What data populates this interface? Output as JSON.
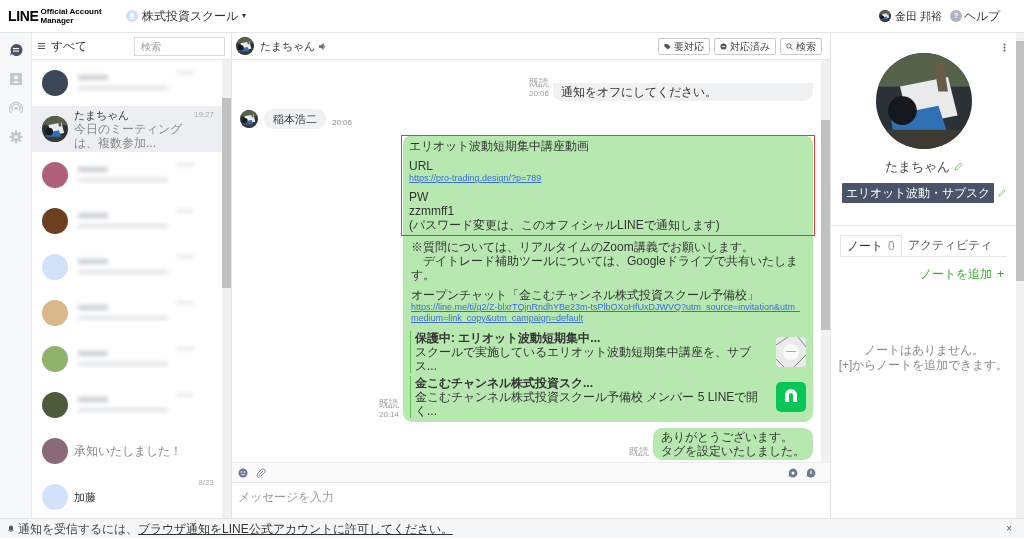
{
  "header": {
    "logo_main": "LINE",
    "logo_sub": "Official Account Manager",
    "account": "株式投資スクール",
    "account_caret": "▾",
    "user": "金田 邦裕",
    "help": "ヘルプ",
    "help_mark": "?"
  },
  "rail": [
    {
      "kind": "chat",
      "selected": true
    },
    {
      "kind": "contacts",
      "selected": false
    },
    {
      "kind": "broadcast",
      "selected": false
    },
    {
      "kind": "settings",
      "selected": false
    }
  ],
  "chat_list": {
    "filter": "すべて",
    "search_placeholder": "検索",
    "items": [
      {
        "kind": "blurred",
        "color": "#3b4656",
        "selected": false
      },
      {
        "kind": "contact",
        "name": "たまちゃん",
        "preview": "今日のミーティングは、複数参加...",
        "time": "19:27",
        "selected": true
      },
      {
        "kind": "blurred",
        "color": "#b0607a",
        "selected": false
      },
      {
        "kind": "blurred",
        "color": "#6b4020",
        "selected": false
      },
      {
        "kind": "blurred",
        "color": "#d3e2fb",
        "selected": false
      },
      {
        "kind": "blurred",
        "color": "#d9b88a",
        "selected": false
      },
      {
        "kind": "blurred",
        "color": "#8fb36a",
        "selected": false
      },
      {
        "kind": "blurred",
        "color": "#4d5a3c",
        "selected": false
      },
      {
        "kind": "partial",
        "preview": "承知いたしました！",
        "color": "#8a6a78",
        "selected": false
      },
      {
        "kind": "default",
        "name": "加藤",
        "time": "8/23",
        "color": "#d3e2fb",
        "selected": false
      }
    ]
  },
  "chat": {
    "title": "たまちゃん",
    "buttons": [
      {
        "kind": "tag",
        "label": "要対応"
      },
      {
        "kind": "done",
        "label": "対応済み"
      },
      {
        "kind": "search",
        "label": "検索"
      }
    ],
    "messages": [
      {
        "kind": "sent",
        "lines": [
          "通知をオフにしてください。"
        ],
        "read": "既読",
        "time": "20:06"
      },
      {
        "kind": "received",
        "text": "稲本浩二",
        "time": "20:06"
      },
      {
        "kind": "rich",
        "read": "既読",
        "time": "20:14",
        "blocks": [
          {
            "highlighted": true,
            "lines": [
              {
                "text": "エリオット波動短期集中講座動画",
                "link": false,
                "gap_before": false
              },
              {
                "text": "URL",
                "link": false,
                "gap_before": true
              },
              {
                "text": "https://pro-trading.design/?p=789",
                "link": true,
                "gap_before": false
              },
              {
                "text": "PW",
                "link": false,
                "gap_before": true
              },
              {
                "text": "zzmmff1",
                "link": false,
                "gap_before": false
              },
              {
                "text": "(パスワード変更は、このオフィシャルLINEで通知します)",
                "link": false,
                "gap_before": false
              }
            ]
          },
          {
            "highlighted": false,
            "lines": [
              {
                "text": "※質問については、リアルタイムのZoom講義でお願いします。",
                "link": false,
                "gap_before": false
              },
              {
                "text": "　デイトレード補助ツールについては、Googleドライブで共有いたします。",
                "link": false,
                "gap_before": false
              },
              {
                "text": "オープンチャット「金こむチャンネル株式投資スクール予備校」",
                "link": false,
                "gap_before": true
              },
              {
                "text": "https://line.me/ti/g2/Z-blxrTQjnRndhYBe23m-tsPlbOXoHfUxDJWVQ?utm_source=invitation&utm_medium=link_copy&utm_campaign=default",
                "link": true,
                "gap_before": false
              }
            ]
          }
        ],
        "cards": [
          {
            "kind": "document",
            "title": "保護中: エリオット波動短期集中...",
            "desc": "スクールで実施しているエリオット波動短期集中講座を、サブス..."
          },
          {
            "kind": "openchat",
            "title": "金こむチャンネル株式投資スク...",
            "desc": "金こむチャンネル株式投資スクール予備校 メンバー 5 LINEで開く..."
          }
        ]
      },
      {
        "kind": "sent",
        "lines": [
          "ありがとうございます。",
          "タグを設定いたしました。"
        ],
        "read": "既読"
      }
    ],
    "input_placeholder": "メッセージを入力"
  },
  "profile": {
    "name": "たまちゃん",
    "tag": "エリオット波動・サブスク",
    "tabs": [
      {
        "label": "ノート",
        "count": "0",
        "selected": true
      },
      {
        "label": "アクティビティ",
        "selected": false
      }
    ],
    "add_note": "ノートを追加",
    "add_mark": "+",
    "empty_lines": [
      "ノートはありません。",
      "[+]からノートを追加できます。"
    ]
  },
  "notice": {
    "prefix": "通知を受信するには、",
    "link": "ブラウザ通知をLINE公式アカウントに許可してください。",
    "close": "×"
  }
}
